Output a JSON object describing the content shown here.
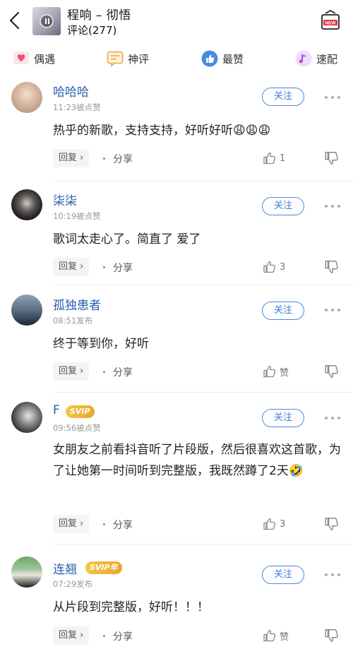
{
  "header": {
    "title": "程响 – 彻悟",
    "subtitle": "评论(277)",
    "new_badge": "NEW"
  },
  "tabs": [
    {
      "label": "偶遇",
      "icon": "heart-chat-icon",
      "color": "#f2507a"
    },
    {
      "label": "神评",
      "icon": "chat-bubble-icon",
      "color": "#f6a23a"
    },
    {
      "label": "最赞",
      "icon": "thumbs-up-icon",
      "color": "#4a8ae0"
    },
    {
      "label": "速配",
      "icon": "music-note-icon",
      "color": "#a35ad8"
    }
  ],
  "actions": {
    "follow": "关注",
    "reply": "回复 ›",
    "share": "分享"
  },
  "comments": [
    {
      "name": "哈哈哈",
      "time": "11:23被点赞",
      "text": "热乎的新歌，支持支持，好听好听",
      "emoji": "😩😩😩",
      "likes": "1"
    },
    {
      "name": "柒柒",
      "time": "10:19被点赞",
      "text": "歌词太走心了。简直了 爱了",
      "likes": "3"
    },
    {
      "name": "孤独患者",
      "time": "08:51发布",
      "text": "终于等到你，好听",
      "likes": "赞"
    },
    {
      "name": "F",
      "badge": "SVIP",
      "time": "09:56被点赞",
      "text": "女朋友之前看抖音听了片段版，然后很喜欢这首歌，为了让她第一时间听到完整版，我既然蹲了2天",
      "emoji": "🤣",
      "likes": "3"
    },
    {
      "name": "连翘",
      "badge": "SVIP年",
      "time": "07:29发布",
      "text": "从片段到完整版，好听！！！",
      "likes": "赞"
    }
  ],
  "colors": {
    "name_blue": "#2a5fae",
    "follow_blue": "#3b7cd8",
    "svip_gold": "#f0b93a"
  }
}
